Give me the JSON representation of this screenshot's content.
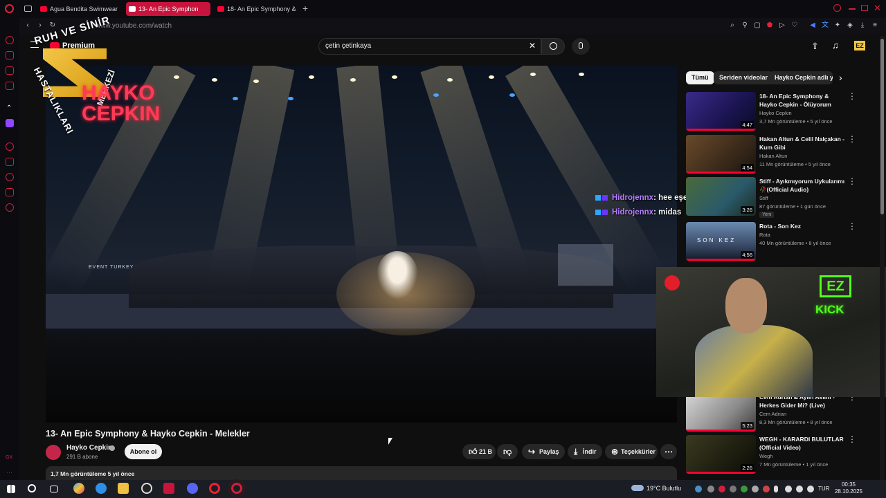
{
  "browser": {
    "tabs": [
      {
        "label": "Agua Bendita Swimwear f"
      },
      {
        "label": "13- An Epic Symphon"
      },
      {
        "label": "18- An Epic Symphony & I"
      }
    ],
    "url": "www.youtube.com/watch"
  },
  "youtube": {
    "premium_label": "Premium",
    "search_value": "çetin çetinkaya",
    "chips": [
      "Tümü",
      "Seriden videolar",
      "Hayko Cepkin adlı yükle"
    ]
  },
  "overlay": {
    "logo_text_top": "RUH VE SİNİR",
    "logo_text_side": "HASTALIKLARI",
    "logo_text_merkezi": "MERKEZİ",
    "logo_hayko": "HAYKO CEPKIN",
    "ez_mark": "EZ",
    "kick_label": "KICK",
    "chat": [
      {
        "user": "Hidrojennx",
        "message": ": hee eşekleri var la"
      },
      {
        "user": "Hidrojennx",
        "message": ": midas"
      }
    ]
  },
  "video": {
    "title": "13- An Epic Symphony & Hayko Cepkin - Melekler",
    "channel": "Hayko Cepkin",
    "subscribers": "291 B abone",
    "subscribe_label": "Abone ol",
    "likes": "21 B",
    "share_label": "Paylaş",
    "download_label": "İndir",
    "thanks_label": "Teşekkürler",
    "views_line": "1,7 Mn görüntüleme  5 yıl önce",
    "stage_sign": "EVENT TURKEY"
  },
  "recommendations": [
    {
      "title": "18- An Epic Symphony & Hayko Cepkin - Ölüyorum",
      "channel": "Hayko Cepkin",
      "meta": "3,7 Mn görüntüleme • 5 yıl önce",
      "duration": "4:47",
      "progress": 1.0,
      "new": ""
    },
    {
      "title": "Hakan Altun & Celil Nalçakan - Kum Gibi",
      "channel": "Hakan Altun",
      "meta": "11 Mn görüntüleme • 5 yıl önce",
      "duration": "4:54",
      "progress": 1.0,
      "new": ""
    },
    {
      "title": "Stiff - Ayıkmıyorum Uykularımı 🥀(Official Audio)",
      "channel": "Stiff",
      "meta": "87 görüntüleme • 1 gün önce",
      "duration": "3:26",
      "progress": 0,
      "new": "Yeni"
    },
    {
      "title": "Rota - Son Kez",
      "channel": "Rota",
      "meta": "40 Mn görüntüleme • 8 yıl önce",
      "duration": "4:56",
      "progress": 1.0,
      "new": "",
      "thumb_text": "SON KEZ"
    },
    {
      "title": "Cem Adrian & Aylin Aslım - Herkes Gider Mi? (Live)",
      "channel": "Cem Adrian",
      "meta": "8,3 Mn görüntüleme • 8 yıl önce",
      "duration": "5:23",
      "progress": 1.0,
      "new": ""
    },
    {
      "title": "WEGH - KARARDI BULUTLAR (Official Video)",
      "channel": "Wegh",
      "meta": "7 Mn görüntüleme • 1 yıl önce",
      "duration": "2:26",
      "progress": 1.0,
      "new": ""
    }
  ],
  "taskbar": {
    "weather": "19°C  Bulutlu",
    "lang": "TUR",
    "time": "00:35",
    "date": "28.10.2025"
  },
  "colors": {
    "accent": "#ff0033",
    "opera": "#d21f3c",
    "kick": "#53fc18",
    "chat_user": "#b57cff"
  }
}
